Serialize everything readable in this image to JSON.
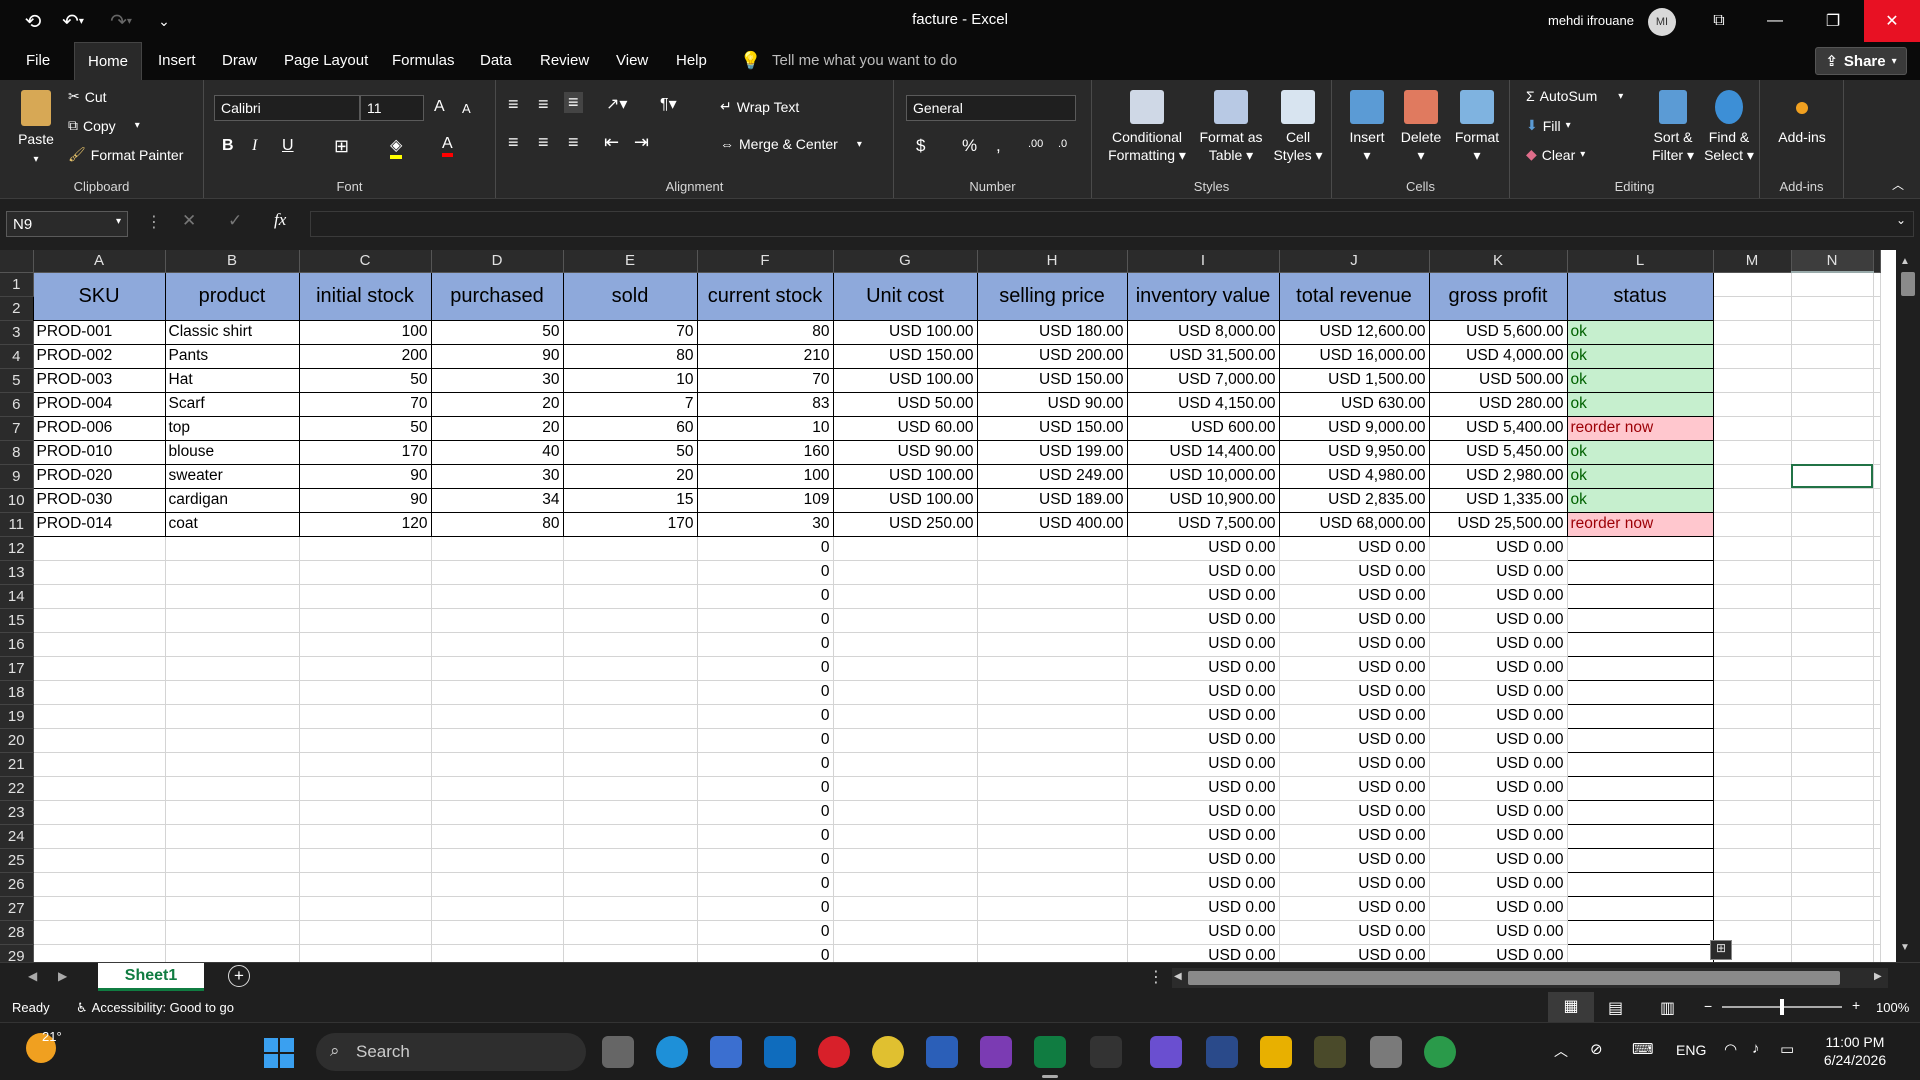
{
  "titlebar": {
    "title": "facture  -  Excel",
    "user_name": "mehdi ifrouane",
    "user_initials": "MI"
  },
  "menu": {
    "file": "File",
    "tabs": [
      "Home",
      "Insert",
      "Draw",
      "Page Layout",
      "Formulas",
      "Data",
      "Review",
      "View",
      "Help"
    ],
    "tell_me": "Tell me what you want to do",
    "share": "Share"
  },
  "ribbon": {
    "clipboard": {
      "label": "Clipboard",
      "paste": "Paste",
      "cut": "Cut",
      "copy": "Copy",
      "format_painter": "Format Painter"
    },
    "font": {
      "label": "Font",
      "name": "Calibri",
      "size": "11",
      "bold": "B",
      "italic": "I",
      "underline": "U",
      "grow": "A",
      "shrink": "A",
      "color_letter": "A"
    },
    "alignment": {
      "label": "Alignment",
      "wrap_text": "Wrap Text",
      "merge_center": "Merge & Center"
    },
    "number": {
      "label": "Number",
      "format": "General",
      "currency": "$",
      "percent": "%",
      "comma": ",",
      "inc_dec": ".00",
      "dec_dec": ".0"
    },
    "styles": {
      "label": "Styles",
      "conditional": [
        "Conditional",
        "Formatting"
      ],
      "format_table": [
        "Format as",
        "Table"
      ],
      "cell_styles": [
        "Cell",
        "Styles"
      ]
    },
    "cells": {
      "label": "Cells",
      "insert": "Insert",
      "delete": "Delete",
      "format": "Format"
    },
    "editing": {
      "label": "Editing",
      "autosum": "AutoSum",
      "fill": "Fill",
      "clear": "Clear",
      "sort_filter": [
        "Sort &",
        "Filter"
      ],
      "find_select": [
        "Find &",
        "Select"
      ]
    },
    "addins": {
      "label": "Add-ins",
      "addins": "Add-ins"
    }
  },
  "formula_bar": {
    "name_box": "N9",
    "fx": "fx",
    "value": ""
  },
  "sheet": {
    "columns": [
      "A",
      "B",
      "C",
      "D",
      "E",
      "F",
      "G",
      "H",
      "I",
      "J",
      "K",
      "L",
      "M",
      "N"
    ],
    "headers": [
      "SKU",
      "product",
      "initial stock",
      "purchased",
      "sold",
      "current stock",
      "Unit cost",
      "selling price",
      "inventory value",
      "total revenue",
      "gross profit",
      "status"
    ],
    "rows": [
      [
        "PROD-001",
        "Classic shirt",
        "100",
        "50",
        "70",
        "80",
        "USD 100.00",
        "USD 180.00",
        "USD 8,000.00",
        "USD 12,600.00",
        "USD 5,600.00",
        "ok"
      ],
      [
        "PROD-002",
        "Pants",
        "200",
        "90",
        "80",
        "210",
        "USD 150.00",
        "USD 200.00",
        "USD 31,500.00",
        "USD 16,000.00",
        "USD 4,000.00",
        "ok"
      ],
      [
        "PROD-003",
        "Hat",
        "50",
        "30",
        "10",
        "70",
        "USD 100.00",
        "USD 150.00",
        "USD 7,000.00",
        "USD 1,500.00",
        "USD 500.00",
        "ok"
      ],
      [
        "PROD-004",
        "Scarf",
        "70",
        "20",
        "7",
        "83",
        "USD 50.00",
        "USD 90.00",
        "USD 4,150.00",
        "USD 630.00",
        "USD 280.00",
        "ok"
      ],
      [
        "PROD-006",
        "top",
        "50",
        "20",
        "60",
        "10",
        "USD 60.00",
        "USD 150.00",
        "USD 600.00",
        "USD 9,000.00",
        "USD 5,400.00",
        "reorder now"
      ],
      [
        "PROD-010",
        "blouse",
        "170",
        "40",
        "50",
        "160",
        "USD 90.00",
        "USD 199.00",
        "USD 14,400.00",
        "USD 9,950.00",
        "USD 5,450.00",
        "ok"
      ],
      [
        "PROD-020",
        "sweater",
        "90",
        "30",
        "20",
        "100",
        "USD 100.00",
        "USD 249.00",
        "USD 10,000.00",
        "USD 4,980.00",
        "USD 2,980.00",
        "ok"
      ],
      [
        "PROD-030",
        "cardigan",
        "90",
        "34",
        "15",
        "109",
        "USD 100.00",
        "USD 189.00",
        "USD 10,900.00",
        "USD 2,835.00",
        "USD 1,335.00",
        "ok"
      ],
      [
        "PROD-014",
        "coat",
        "120",
        "80",
        "170",
        "30",
        "USD 250.00",
        "USD 400.00",
        "USD 7,500.00",
        "USD 68,000.00",
        "USD 25,500.00",
        "reorder now"
      ]
    ],
    "empty_row": {
      "current_stock": "0",
      "usd_zero": "USD 0.00"
    },
    "row_numbers": [
      "1",
      "2",
      "3",
      "4",
      "5",
      "6",
      "7",
      "8",
      "9",
      "10",
      "11",
      "12",
      "13",
      "14",
      "15",
      "16",
      "17",
      "18",
      "19",
      "20",
      "21",
      "22",
      "23",
      "24",
      "25",
      "26",
      "27",
      "28",
      "29"
    ],
    "selected_cell": "N9"
  },
  "sheet_tabs": {
    "active": "Sheet1"
  },
  "status": {
    "ready": "Ready",
    "accessibility": "Accessibility: Good to go",
    "zoom": "100%"
  },
  "taskbar": {
    "weather": "21°",
    "search": "Search",
    "lang": "ENG",
    "time": "11:00 PM",
    "date": "6/24/2026"
  },
  "colors": {
    "header_fill": "#8ea9db",
    "ok_fill": "#c6efce",
    "ok_text": "#006100",
    "reorder_fill": "#ffc7ce",
    "reorder_text": "#9c0006",
    "excel_green": "#107c41",
    "close_red": "#e81123"
  }
}
